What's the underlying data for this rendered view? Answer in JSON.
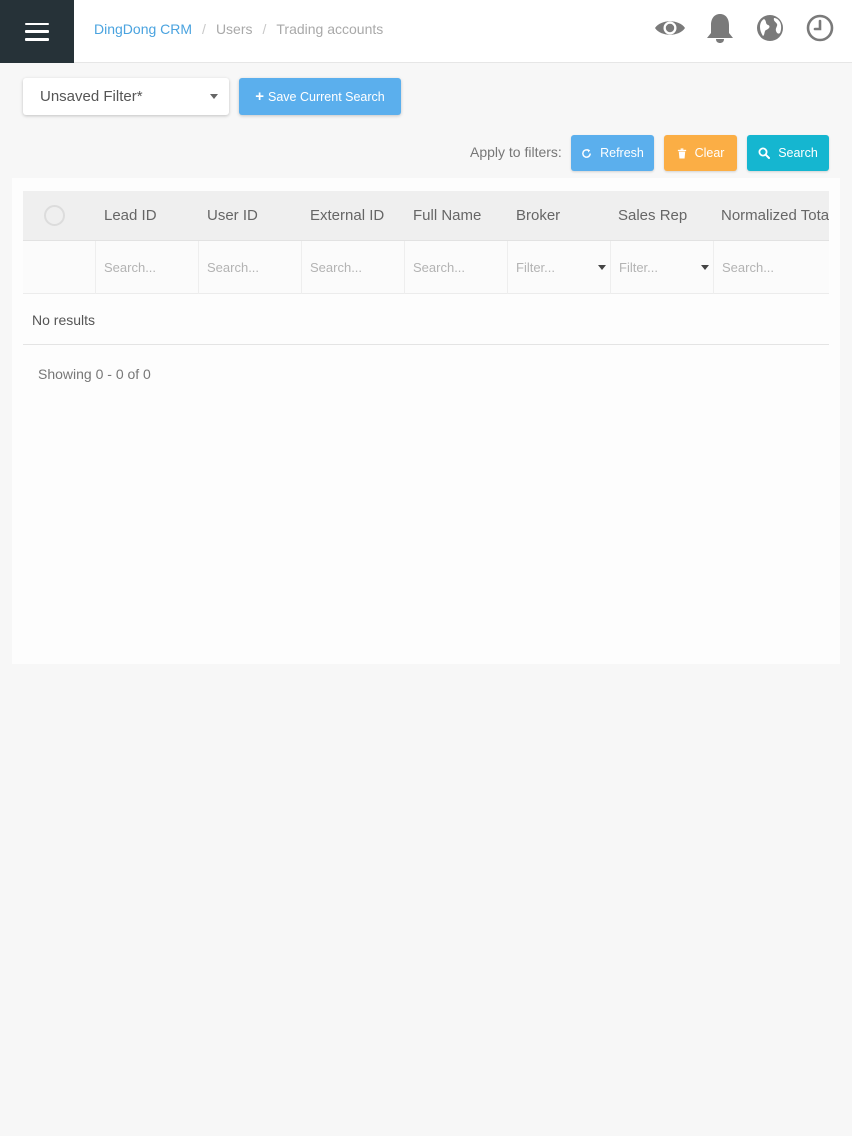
{
  "app": {
    "brand": "DingDong CRM"
  },
  "breadcrumb": {
    "items": [
      "DingDong CRM",
      "Users",
      "Trading accounts"
    ]
  },
  "top_icons": [
    "eye-icon",
    "bell-icon",
    "globe-icon",
    "clock-icon"
  ],
  "toolbar": {
    "filter_select_value": "Unsaved Filter*",
    "save_search_label": "Save Current Search",
    "apply_to_filters_label": "Apply to filters:",
    "refresh_label": "Refresh",
    "clear_label": "Clear",
    "search_label": "Search"
  },
  "table": {
    "columns": [
      "Lead ID",
      "User ID",
      "External ID",
      "Full Name",
      "Broker",
      "Sales Rep",
      "Normalized Total"
    ],
    "filters": [
      {
        "placeholder": "Search...",
        "type": "text"
      },
      {
        "placeholder": "Search...",
        "type": "text"
      },
      {
        "placeholder": "Search...",
        "type": "text"
      },
      {
        "placeholder": "Search...",
        "type": "text"
      },
      {
        "placeholder": "Filter...",
        "type": "select"
      },
      {
        "placeholder": "Filter...",
        "type": "select"
      },
      {
        "placeholder": "Search...",
        "type": "text"
      }
    ],
    "empty_text": "No results"
  },
  "pagination": {
    "showing_text": "Showing 0 - 0 of 0"
  },
  "colors": {
    "sidebar_dark": "#263238",
    "link_blue": "#4aa3df",
    "refresh_blue": "#5bafed",
    "clear_orange": "#fbae45",
    "search_teal": "#15b6d0"
  }
}
